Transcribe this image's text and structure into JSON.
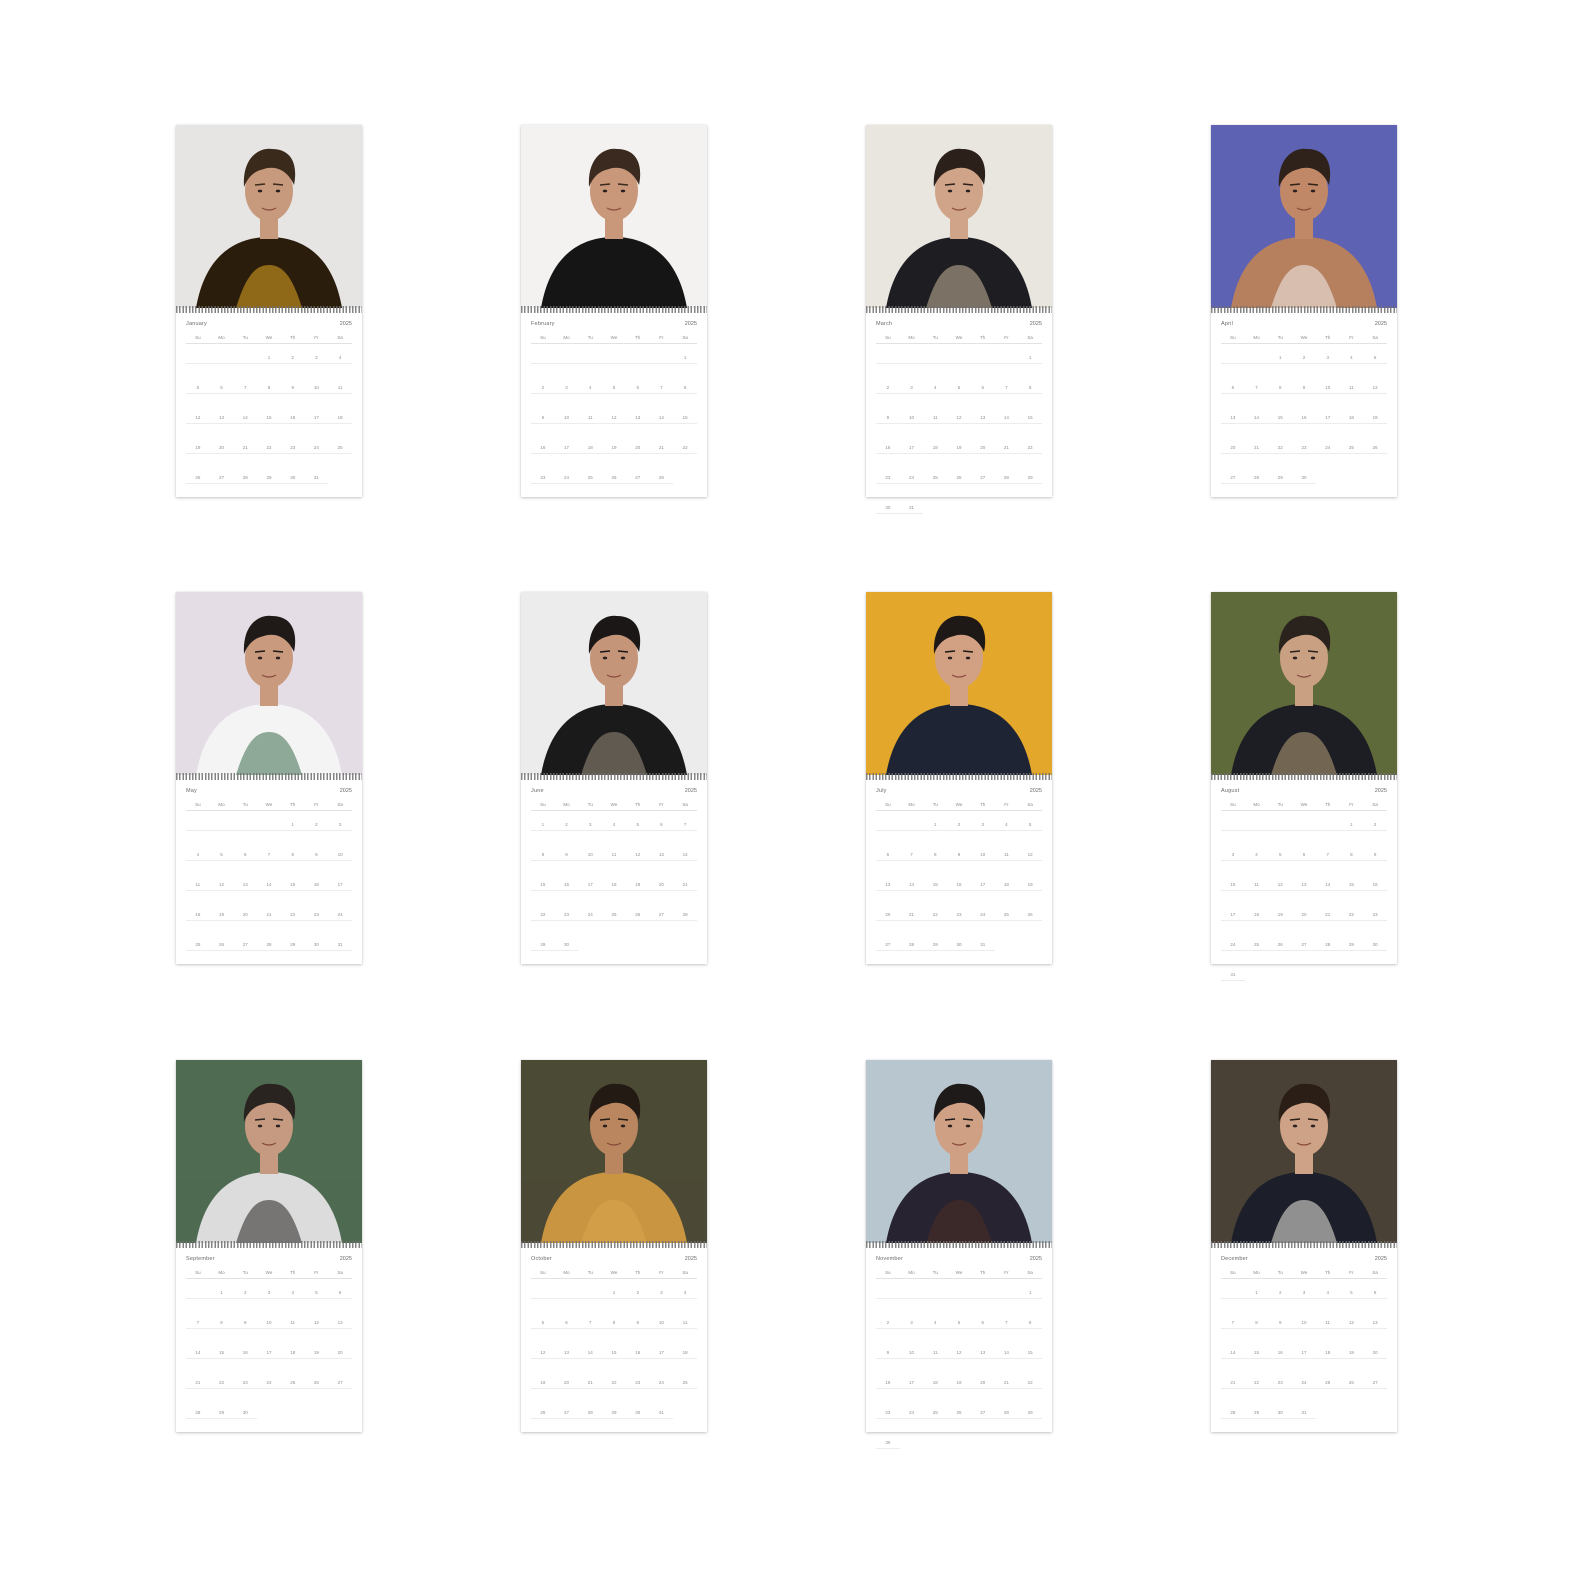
{
  "year": "2025",
  "weekdays": [
    "Su",
    "Mo",
    "Tu",
    "We",
    "Th",
    "Fr",
    "Sa"
  ],
  "months": [
    {
      "name": "January",
      "start": 3,
      "days": 31,
      "bg": "#e7e4e4",
      "accent": "#3a2a1c",
      "skin": "#c79a7d",
      "cloth": "#2b1d0c",
      "cloth2": "#e2a622"
    },
    {
      "name": "February",
      "start": 6,
      "days": 28,
      "bg": "#f3f2f0",
      "accent": "#3a2a1f",
      "skin": "#c9987a",
      "cloth": "#151515",
      "cloth2": "#151515"
    },
    {
      "name": "March",
      "start": 6,
      "days": 31,
      "bg": "#e9e6e0",
      "accent": "#2b201a",
      "skin": "#d0a488",
      "cloth": "#1d1d22",
      "cloth2": "#c9b79a"
    },
    {
      "name": "April",
      "start": 2,
      "days": 30,
      "bg": "#5d62b3",
      "accent": "#2e221a",
      "skin": "#c08867",
      "cloth": "#b67f5e",
      "cloth2": "#f2f2f2"
    },
    {
      "name": "May",
      "start": 4,
      "days": 31,
      "bg": "#e4dde6",
      "accent": "#1f1a18",
      "skin": "#c99a7e",
      "cloth": "#f4f4f4",
      "cloth2": "#3b6b4b"
    },
    {
      "name": "June",
      "start": 0,
      "days": 30,
      "bg": "#ececec",
      "accent": "#1b1716",
      "skin": "#c5957a",
      "cloth": "#1a1a1a",
      "cloth2": "#9b8f80"
    },
    {
      "name": "July",
      "start": 2,
      "days": 31,
      "bg": "#e3a72c",
      "accent": "#1e1816",
      "skin": "#d2a183",
      "cloth": "#1f2435",
      "cloth2": "#1f2435"
    },
    {
      "name": "August",
      "start": 5,
      "days": 31,
      "bg": "#5f6a3a",
      "accent": "#2a221c",
      "skin": "#caa083",
      "cloth": "#1d1e24",
      "cloth2": "#b8a27a"
    },
    {
      "name": "September",
      "start": 1,
      "days": 30,
      "bg": "#4f6b52",
      "accent": "#2a2420",
      "skin": "#c59a80",
      "cloth": "#dcdcdc",
      "cloth2": "#23201f"
    },
    {
      "name": "October",
      "start": 3,
      "days": 31,
      "bg": "#4b4a35",
      "accent": "#231a14",
      "skin": "#b98660",
      "cloth": "#c99540",
      "cloth2": "#d9a84e"
    },
    {
      "name": "November",
      "start": 6,
      "days": 30,
      "bg": "#b8c6cf",
      "accent": "#1f1a1a",
      "skin": "#d0a085",
      "cloth": "#272331",
      "cloth2": "#4d2d22"
    },
    {
      "name": "December",
      "start": 1,
      "days": 31,
      "bg": "#4a4136",
      "accent": "#2a1e17",
      "skin": "#cea287",
      "cloth": "#1c1f2a",
      "cloth2": "#f0ece4"
    }
  ]
}
